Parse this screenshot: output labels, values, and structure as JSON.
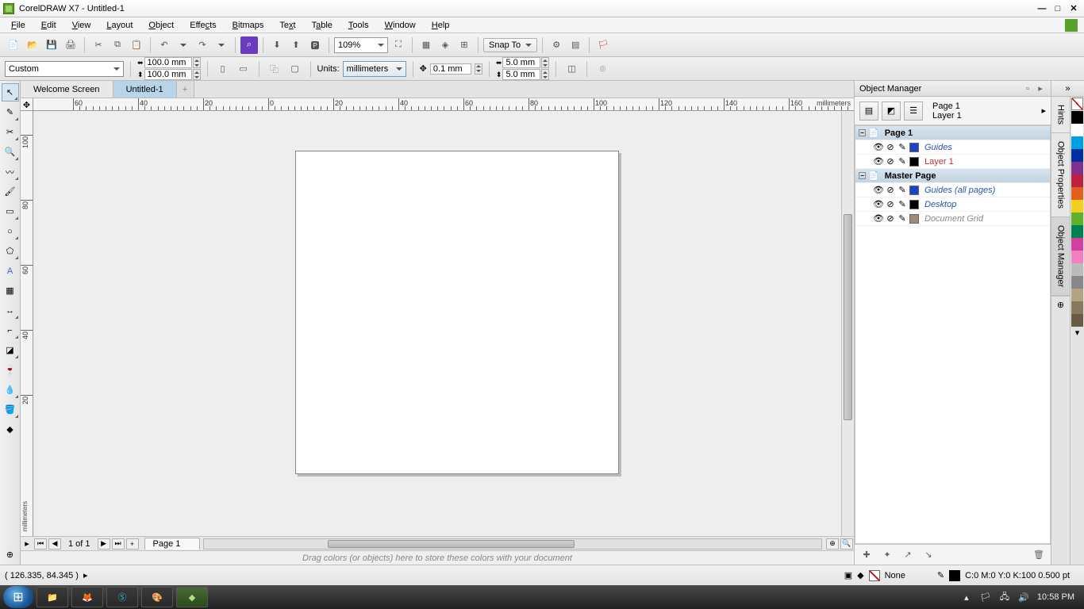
{
  "title": "CorelDRAW X7 - Untitled-1",
  "menu": [
    "File",
    "Edit",
    "View",
    "Layout",
    "Object",
    "Effects",
    "Bitmaps",
    "Text",
    "Table",
    "Tools",
    "Window",
    "Help"
  ],
  "menu_accel": [
    "F",
    "E",
    "V",
    "L",
    "O",
    "E",
    "B",
    "T",
    "T",
    "T",
    "W",
    "H"
  ],
  "toolbar": {
    "zoom": "109%",
    "snap_to": "Snap To"
  },
  "propbar": {
    "page_preset": "Custom",
    "width": "100.0 mm",
    "height": "100.0 mm",
    "units_label": "Units:",
    "units": "millimeters",
    "nudge": "0.1 mm",
    "dup_x": "5.0 mm",
    "dup_y": "5.0 mm"
  },
  "doctabs": [
    {
      "label": "Welcome Screen",
      "active": false
    },
    {
      "label": "Untitled-1",
      "active": true
    }
  ],
  "ruler": {
    "h_labels": [
      "60",
      "40",
      "20",
      "0",
      "20",
      "40",
      "60",
      "80",
      "100",
      "120",
      "140",
      "160"
    ],
    "h_unit": "millimeters",
    "v_labels": [
      "100",
      "80",
      "60",
      "40",
      "20"
    ],
    "v_unit": "millimeters"
  },
  "pagenav": {
    "count": "1 of 1",
    "tab": "Page 1"
  },
  "color_dock_hint": "Drag colors (or objects) here to store these colors with your document",
  "object_manager": {
    "title": "Object Manager",
    "page": "Page 1",
    "layer": "Layer 1",
    "tree": [
      {
        "type": "page",
        "label": "Page 1",
        "expanded": true
      },
      {
        "type": "layer",
        "label": "Guides",
        "color": "#2040d0",
        "style": "blue",
        "indent": 1
      },
      {
        "type": "layer",
        "label": "Layer 1",
        "color": "#000000",
        "style": "red",
        "indent": 1
      },
      {
        "type": "page",
        "label": "Master Page",
        "expanded": true
      },
      {
        "type": "layer",
        "label": "Guides (all pages)",
        "color": "#2040d0",
        "style": "blue",
        "indent": 1
      },
      {
        "type": "layer",
        "label": "Desktop",
        "color": "#000000",
        "style": "blue",
        "indent": 1
      },
      {
        "type": "layer",
        "label": "Document Grid",
        "color": "#9a8a78",
        "style": "gray",
        "indent": 1
      }
    ]
  },
  "vtabs": [
    "Hints",
    "Object Properties",
    "Object Manager"
  ],
  "palette_colors": [
    "#000000",
    "#ffffff",
    "#00a0e0",
    "#0030a0",
    "#803090",
    "#c02040",
    "#e06020",
    "#f0d020",
    "#60b030",
    "#008050",
    "#d040a0",
    "#f080c0",
    "#bbbbbb",
    "#888888",
    "#b4a284",
    "#8a7a5c",
    "#6a5c44"
  ],
  "status": {
    "coords": "( 126.335, 84.345 )",
    "fill": "None",
    "outline": "C:0 M:0 Y:0 K:100  0.500 pt"
  },
  "taskbar": {
    "time": "10:58 PM"
  }
}
